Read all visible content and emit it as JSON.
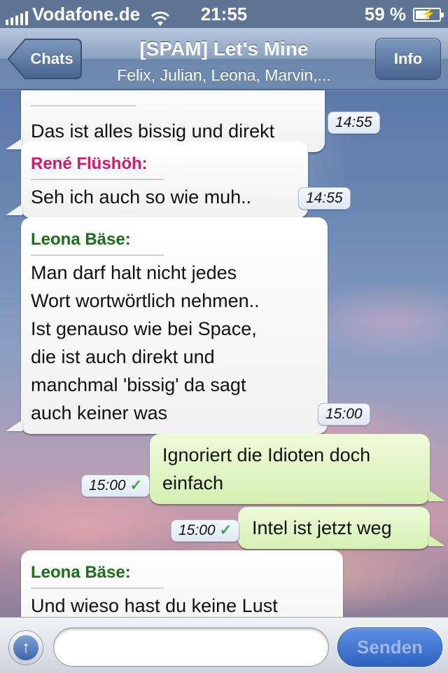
{
  "status_bar": {
    "carrier": "Vodafone.de",
    "time": "21:55",
    "battery": "59 %",
    "battery_level": 0.59
  },
  "nav": {
    "back_label": "Chats",
    "title": "[SPAM] Let's Mine",
    "subtitle": "Felix, Julian, Leona, Marvin,...",
    "info_label": "Info"
  },
  "messages": [
    {
      "direction": "in",
      "sender": "",
      "text": "Das ist alles bissig und direkt",
      "time": "14:55"
    },
    {
      "direction": "in",
      "sender": "René Flüshöh:",
      "sender_color": "#d2186f",
      "text": "Seh ich auch so wie muh..",
      "time": "14:55"
    },
    {
      "direction": "in",
      "sender": "Leona Bäse:",
      "sender_color": "#1f6b1f",
      "text": "Man darf halt nicht jedes\nWort wortwörtlich nehmen..\nIst genauso wie bei Space,\ndie ist auch direkt und\nmanchmal 'bissig' da sagt\nauch keiner was",
      "time": "15:00"
    },
    {
      "direction": "out",
      "text": "Ignoriert die Idioten doch\neinfach",
      "time": "15:00",
      "status": "delivered-check"
    },
    {
      "direction": "out",
      "text": "Intel ist jetzt weg",
      "time": "15:00",
      "status": "delivered-check"
    },
    {
      "direction": "in",
      "sender": "Leona Bäse:",
      "sender_color": "#1f6b1f",
      "text": "Und wieso hast du keine Lust",
      "time": ""
    }
  ],
  "input_bar": {
    "attach_icon": "upload-arrow-icon",
    "placeholder": "",
    "send_label": "Senden"
  },
  "colors": {
    "nav_bar": "#6f8ab0",
    "incoming_bubble": "#ffffff",
    "outgoing_bubble": "#d6f0b4",
    "send_button": "#2e63c2",
    "check": "#3aa33a"
  }
}
